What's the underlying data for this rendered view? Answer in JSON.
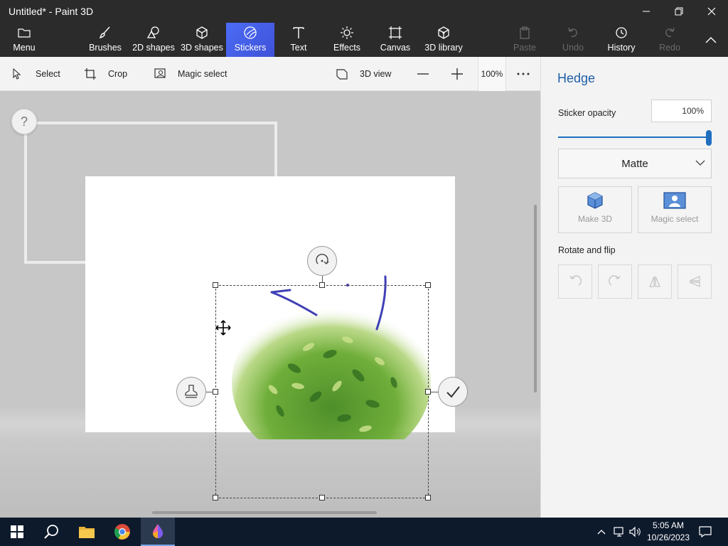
{
  "window": {
    "title": "Untitled* - Paint 3D"
  },
  "ribbon": {
    "menu": "Menu",
    "brushes": "Brushes",
    "shapes2d": "2D shapes",
    "shapes3d": "3D shapes",
    "stickers": "Stickers",
    "text": "Text",
    "effects": "Effects",
    "canvas": "Canvas",
    "library3d": "3D library",
    "paste": "Paste",
    "undo": "Undo",
    "history": "History",
    "redo": "Redo"
  },
  "toolbar": {
    "select": "Select",
    "crop": "Crop",
    "magic_select": "Magic select",
    "view3d": "3D view",
    "zoom": "100%"
  },
  "canvas": {
    "help": "?"
  },
  "panel": {
    "title": "Hedge",
    "opacity_label": "Sticker opacity",
    "opacity_value": "100%",
    "opacity_level": 1.0,
    "finish": "Matte",
    "make3d": "Make 3D",
    "magic_select": "Magic select",
    "rotate_flip": "Rotate and flip"
  },
  "taskbar": {
    "time": "5:05 AM",
    "date": "10/26/2023"
  },
  "colors": {
    "accent": "#1f6fbf",
    "active_tab": "#4b6cf6",
    "ink": "#4a3fb8"
  }
}
